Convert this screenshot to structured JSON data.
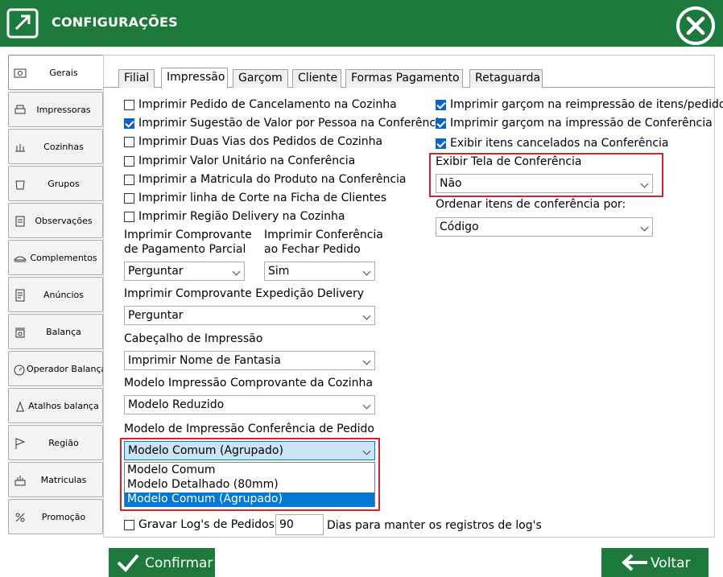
{
  "window": {
    "title": "CONFIGURAÇÕES"
  },
  "sidebar": {
    "items": [
      {
        "label": "Gerais",
        "icon": "settings-icon",
        "active": true
      },
      {
        "label": "Impressoras",
        "icon": "printer-icon"
      },
      {
        "label": "Cozinhas",
        "icon": "kitchen-icon"
      },
      {
        "label": "Grupos",
        "icon": "groups-icon"
      },
      {
        "label": "Observações",
        "icon": "notes-icon"
      },
      {
        "label": "Complementos",
        "icon": "complements-icon"
      },
      {
        "label": "Anúncios",
        "icon": "document-icon"
      },
      {
        "label": "Balança",
        "icon": "scale-icon"
      },
      {
        "label": "Operador Balança",
        "icon": "scale-operator-icon"
      },
      {
        "label": "Atalhos balança",
        "icon": "scale-shortcut-icon"
      },
      {
        "label": "Região",
        "icon": "flag-icon"
      },
      {
        "label": "Matriculas",
        "icon": "registrations-icon"
      },
      {
        "label": "Promoção",
        "icon": "promotion-icon"
      }
    ]
  },
  "tabs": [
    {
      "label": "Filial"
    },
    {
      "label": "Impressão",
      "active": true
    },
    {
      "label": "Garçom"
    },
    {
      "label": "Cliente"
    },
    {
      "label": "Formas Pagamento"
    },
    {
      "label": "Retaguarda"
    }
  ],
  "left_checks": [
    {
      "label": "Imprimir Pedido de Cancelamento na Cozinha",
      "checked": false
    },
    {
      "label": "Imprimir Sugestão de Valor por Pessoa na Conferência",
      "checked": true
    },
    {
      "label": "Imprimir Duas Vias dos Pedidos de Cozinha",
      "checked": false
    },
    {
      "label": "Imprimir Valor Unitário na Conferência",
      "checked": false
    },
    {
      "label": "Imprimir a Matricula do Produto na Conferência",
      "checked": false
    },
    {
      "label": "Imprimir linha de Corte na Ficha de Clientes",
      "checked": false
    },
    {
      "label": "Imprimir Região Delivery na Cozinha",
      "checked": false
    }
  ],
  "right_checks": [
    {
      "label": "Imprimir garçom na reimpressão de itens/pedido",
      "checked": true
    },
    {
      "label": "Imprimir garçom na impressão de Conferência",
      "checked": true
    },
    {
      "label": "Exibir itens cancelados na Conferência",
      "checked": true
    }
  ],
  "fields": {
    "comprovante_parcial": {
      "label_1": "Imprimir Comprovante",
      "label_2": "de Pagamento Parcial",
      "value": "Perguntar"
    },
    "conferencia_fechar": {
      "label_1": "Imprimir Conferência",
      "label_2": "ao Fechar Pedido",
      "value": "Sim"
    },
    "expedicao_delivery": {
      "label": "Imprimir Comprovante Expedição Delivery",
      "value": "Perguntar"
    },
    "cabecalho": {
      "label": "Cabeçalho de Impressão",
      "value": "Imprimir Nome de Fantasia"
    },
    "modelo_cozinha": {
      "label": "Modelo Impressão Comprovante da Cozinha",
      "value": "Modelo Reduzido"
    },
    "modelo_conferencia": {
      "label": "Modelo de Impressão Conferência de Pedido",
      "value": "Modelo Comum (Agrupado)",
      "options": [
        "Modelo Comum",
        "Modelo Detalhado (80mm)",
        "Modelo Comum (Agrupado)"
      ]
    },
    "exibir_tela": {
      "label": "Exibir Tela de Conferência",
      "value": "Não"
    },
    "ordenar": {
      "label": "Ordenar itens de conferência por:",
      "value": "Código"
    }
  },
  "log": {
    "label": "Gravar Log's de Pedidos",
    "checked": false,
    "days": "90",
    "suffix": "Dias para manter os registros de log's"
  },
  "buttons": {
    "confirm": "Confirmar",
    "back": "Voltar"
  },
  "colors": {
    "brand_green": "#1e7a3c",
    "highlight_red": "#d6222a",
    "selection_blue": "#0078d7",
    "checkbox_blue": "#0a64c8"
  }
}
